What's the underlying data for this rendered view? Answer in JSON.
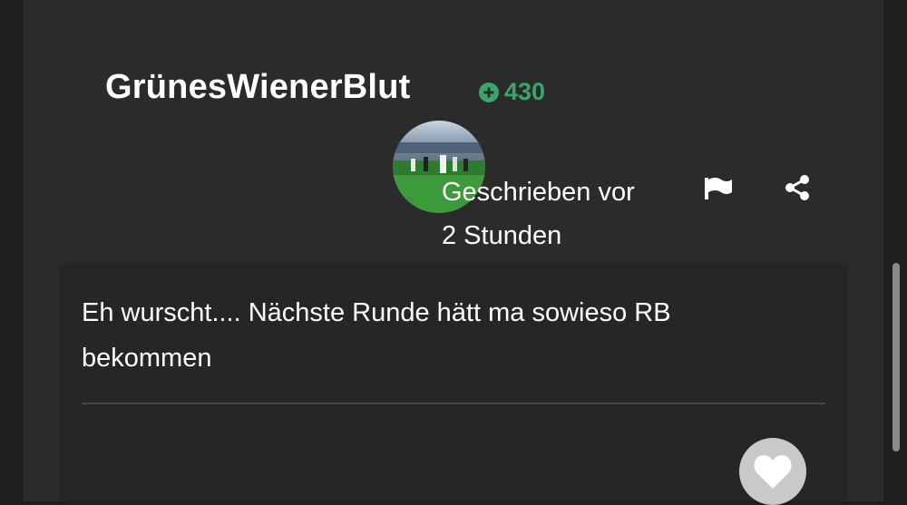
{
  "post": {
    "author": "GrünesWienerBlut",
    "reputation": "430",
    "meta_line1": "Geschrieben vor",
    "meta_line2": "2 Stunden",
    "body_line1": "Eh wurscht.... Nächste Runde hätt ma sowieso RB",
    "body_line2": "bekommen"
  },
  "icons": {
    "reputation": "plus-circle-icon",
    "report": "flag-icon",
    "share": "share-icon",
    "like": "heart-icon"
  },
  "colors": {
    "background": "#1f1f1f",
    "panel": "#2b2b2b",
    "post_box": "#262626",
    "reputation": "#3aa66b",
    "text": "#ffffff",
    "like_button": "#c9c9c9"
  }
}
